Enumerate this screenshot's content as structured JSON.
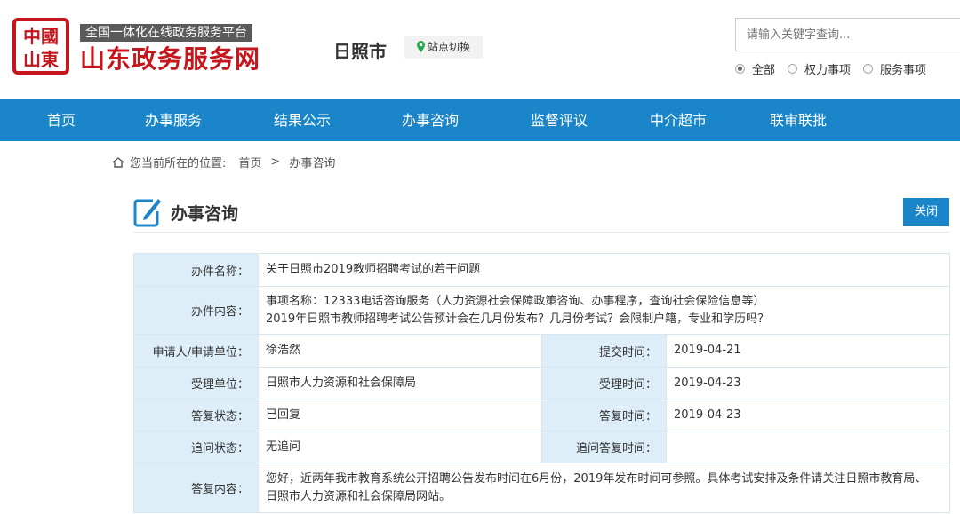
{
  "header": {
    "seal_text": "中國山東",
    "slogan": "全国一体化在线政务服务平台",
    "site_name": "山东政务服务网",
    "city": "日照市",
    "switch_label": "站点切换",
    "search_placeholder": "请输入关键字查询...",
    "search_scope": [
      {
        "label": "全部",
        "checked": true
      },
      {
        "label": "权力事项",
        "checked": false
      },
      {
        "label": "服务事项",
        "checked": false
      }
    ]
  },
  "nav": {
    "items": [
      "首页",
      "办事服务",
      "结果公示",
      "办事咨询",
      "监督评议",
      "中介超市",
      "联审联批"
    ]
  },
  "breadcrumb": {
    "prefix": "您当前所在的位置:",
    "items": [
      "首页",
      "办事咨询"
    ],
    "separator": ">"
  },
  "page": {
    "title": "办事咨询",
    "close_label": "关闭"
  },
  "details": {
    "name_label": "办件名称：",
    "name_value": "关于日照市2019教师招聘考试的若干问题",
    "content_label": "办件内容：",
    "content_line1": "事项名称：12333电话咨询服务（人力资源社会保障政策咨询、办事程序，查询社会保险信息等）",
    "content_line2": "2019年日照市教师招聘考试公告预计会在几月份发布？几月份考试？会限制户籍，专业和学历吗？",
    "applicant_label": "申请人/申请单位：",
    "applicant_value": "徐浩然",
    "submit_time_label": "提交时间：",
    "submit_time_value": "2019-04-21",
    "accept_unit_label": "受理单位：",
    "accept_unit_value": "日照市人力资源和社会保障局",
    "accept_time_label": "受理时间：",
    "accept_time_value": "2019-04-23",
    "reply_status_label": "答复状态：",
    "reply_status_value": "已回复",
    "reply_time_label": "答复时间：",
    "reply_time_value": "2019-04-23",
    "followup_status_label": "追问状态：",
    "followup_status_value": "无追问",
    "followup_reply_time_label": "追问答复时间：",
    "followup_reply_time_value": "",
    "reply_content_label": "答复内容：",
    "reply_content_value": "您好，近两年我市教育系统公开招聘公告发布时间在6月份，2019年发布时间可参照。具体考试安排及条件请关注日照市教育局、日照市人力资源和社会保障局网站。"
  },
  "colors": {
    "brand_red": "#c4161c",
    "nav_blue": "#1a85c8",
    "label_bg": "#ddeef9"
  }
}
